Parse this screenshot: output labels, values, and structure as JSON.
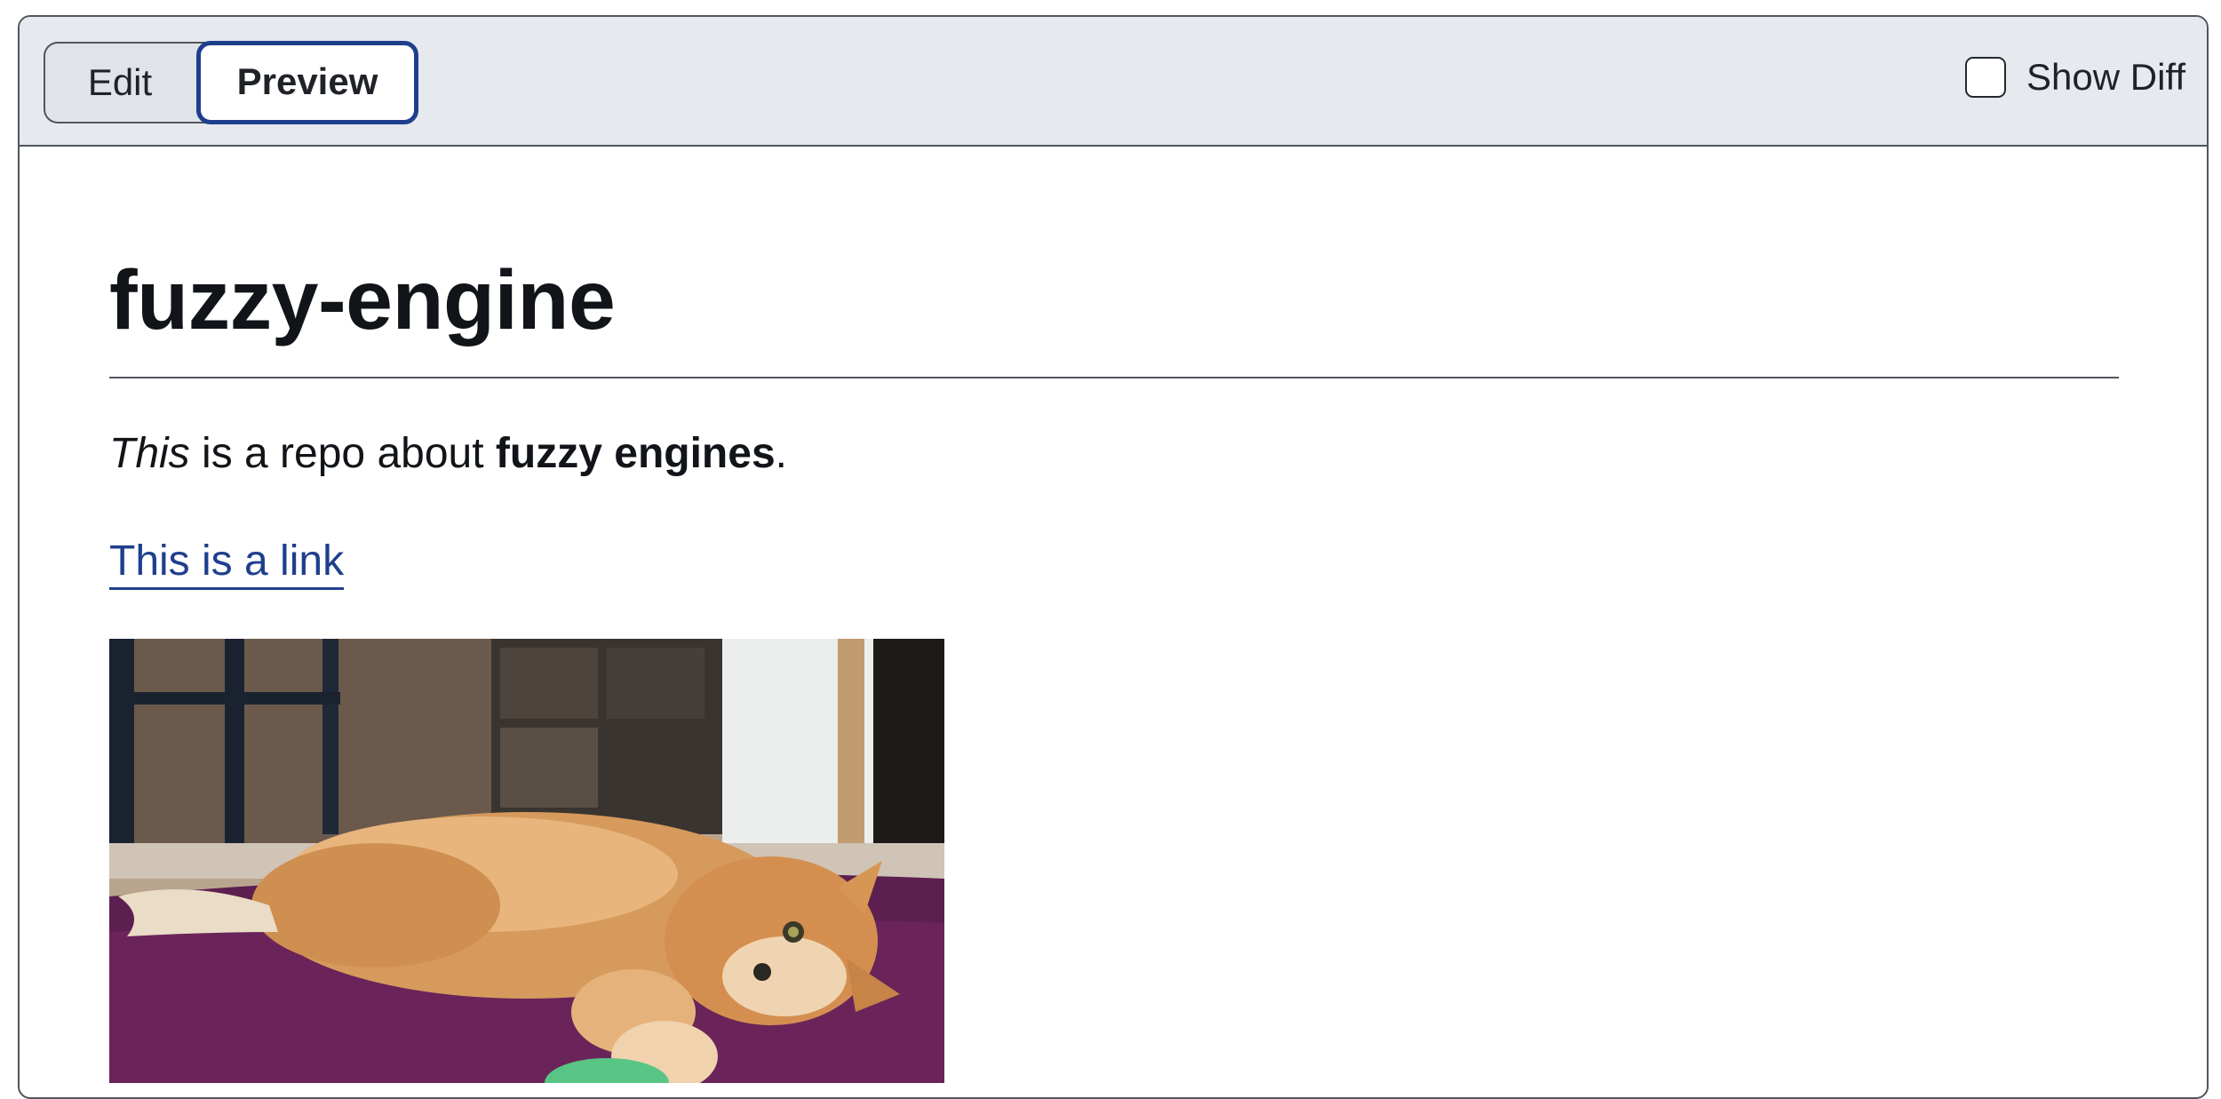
{
  "toolbar": {
    "tabs": [
      {
        "label": "Edit",
        "active": false
      },
      {
        "label": "Preview",
        "active": true
      }
    ],
    "show_diff": {
      "label": "Show Diff",
      "checked": false
    }
  },
  "preview": {
    "title": "fuzzy-engine",
    "paragraph": {
      "italic": "This",
      "text_mid": " is a repo about ",
      "bold": "fuzzy engines",
      "text_end": "."
    },
    "link_text": "This is a link",
    "image_subject": "orange cat lying on purple rug"
  },
  "colors": {
    "accent": "#1f3f8d",
    "toolbar_bg": "#e6e9ee",
    "border": "#50565e"
  }
}
